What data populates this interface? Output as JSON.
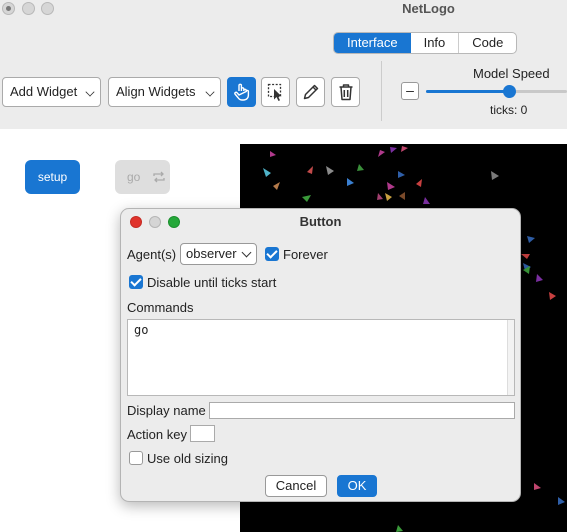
{
  "window": {
    "title": "NetLogo"
  },
  "tabs": [
    {
      "label": "Interface",
      "active": true
    },
    {
      "label": "Info",
      "active": false
    },
    {
      "label": "Code",
      "active": false
    }
  ],
  "toolbar": {
    "add_widget": "Add Widget",
    "align_widgets": "Align Widgets",
    "tools": [
      "pointer-hand-icon",
      "select-cursor-icon",
      "pencil-icon",
      "trash-icon"
    ]
  },
  "speed": {
    "label": "Model Speed",
    "minus": "–",
    "level": 0.59,
    "ticks_text": "ticks: 0"
  },
  "widgets": {
    "setup_label": "setup",
    "go_label": "go"
  },
  "colors": {
    "accent": "#1976d2",
    "world_bg": "#000000"
  },
  "dialog": {
    "title": "Button",
    "agents_label": "Agent(s)",
    "agents_value": "observer",
    "forever_label": "Forever",
    "forever_checked": true,
    "disable_label": "Disable until ticks start",
    "disable_checked": true,
    "commands_label": "Commands",
    "commands_value": "go",
    "display_name_label": "Display name",
    "display_name_value": "",
    "action_key_label": "Action key",
    "action_key_value": "",
    "old_sizing_label": "Use old sizing",
    "old_sizing_checked": false,
    "cancel_label": "Cancel",
    "ok_label": "OK"
  }
}
